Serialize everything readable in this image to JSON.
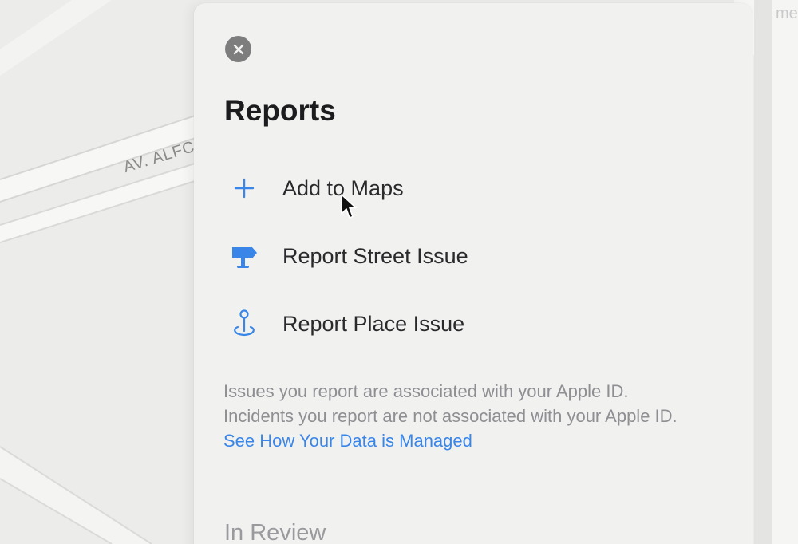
{
  "map": {
    "street_label": "AV. ALFC",
    "right_edge_text": "me"
  },
  "panel": {
    "close_icon": "close-icon",
    "title": "Reports",
    "items": [
      {
        "label": "Add to Maps",
        "icon": "plus-icon"
      },
      {
        "label": "Report Street Issue",
        "icon": "street-sign-icon"
      },
      {
        "label": "Report Place Issue",
        "icon": "place-pin-icon"
      }
    ],
    "footnote_text": "Issues you report are associated with your Apple ID. Incidents you report are not associated with your Apple ID. ",
    "footnote_link": "See How Your Data is Managed",
    "section_title": "In Review"
  },
  "colors": {
    "accent": "#3a86e8",
    "title": "#1c1c1e",
    "secondary_text": "#8e8e93",
    "panel_bg": "#f1f1f0",
    "close_button": "#7d7d7d"
  }
}
